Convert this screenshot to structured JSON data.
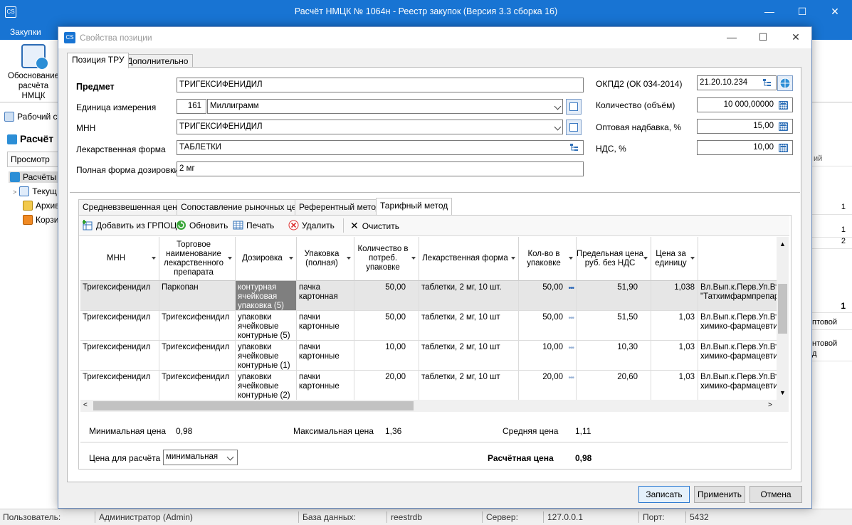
{
  "main_window": {
    "title": "Расчёт НМЦК № 1064н - Реестр закупок (Версия 3.3 сборка 16)",
    "app_icon_text": "CS",
    "ribbon_tab": "Закупки",
    "ribbon_button_line1": "Обоснование",
    "ribbon_button_line2": "расчёта НМЦК",
    "left_panel": {
      "workspace_tab": "Рабочий ст",
      "section_title": "Расчёт",
      "view_button": "Просмотр",
      "tree_root": "Расчёты",
      "tree_items": [
        "Текущ",
        "Архив",
        "Корзи"
      ]
    },
    "right_panel_values": [
      "ий",
      "1",
      "1",
      "2",
      "1",
      "птовой",
      "нтовой",
      "д"
    ],
    "statusbar": {
      "user_label": "Пользователь:",
      "user_value": "Администратор (Admin)",
      "db_label": "База данных:",
      "db_value": "reestrdb",
      "server_label": "Сервер:",
      "server_value": "127.0.0.1",
      "port_label": "Порт:",
      "port_value": "5432"
    }
  },
  "dialog": {
    "title": "Свойства позиции",
    "tabs": [
      "Позиция ТРУ",
      "Дополнительно"
    ],
    "fields": {
      "subject_label": "Предмет",
      "subject_value": "ТРИГЕКСИФЕНИДИЛ",
      "unit_label": "Единица измерения",
      "unit_code": "161",
      "unit_value": "Миллиграмм",
      "mnn_label": "МНН",
      "mnn_value": "ТРИГЕКСИФЕНИДИЛ",
      "form_label": "Лекарственная форма",
      "form_value": "ТАБЛЕТКИ",
      "dosage_label": "Полная форма дозировки",
      "dosage_value": "2 мг",
      "okpd_label": "ОКПД2 (ОК 034-2014)",
      "okpd_value": "21.20.10.234",
      "qty_label": "Количество (объём)",
      "qty_value": "10 000,00000",
      "markup_label": "Оптовая надбавка, %",
      "markup_value": "15,00",
      "vat_label": "НДС, %",
      "vat_value": "10,00"
    },
    "method_tabs": [
      "Средневзвешенная цена",
      "Сопоставление рыночных цен",
      "Референтный метод",
      "Тарифный метод"
    ],
    "toolbar": {
      "add": "Добавить из ГРПОЦ",
      "refresh": "Обновить",
      "print": "Печать",
      "delete": "Удалить",
      "clear": "Очистить"
    },
    "grid": {
      "columns": [
        "МНН",
        "Торговое наименование лекарственного препарата",
        "Дозировка",
        "Упаковка (полная)",
        "Количество в потреб. упаковке",
        "Лекарственная форма",
        "Кол-во в упаковке",
        "Предельная цена руб. без НДС",
        "Цена за единицу",
        ""
      ],
      "rows": [
        [
          "Тригексифенидил",
          "Паркопан",
          "контурная ячейковая упаковка (5)",
          "пачка картонная",
          "50,00",
          "таблетки, 2 мг, 10 шт.",
          "50,00",
          "51,90",
          "1,038",
          "Вл.Вып.к.Перв.Уп.Вто \"Татхимфармпрепарат"
        ],
        [
          "Тригексифенидил",
          "Тригексифенидил",
          "упаковки ячейковые контурные (5)",
          "пачки картонные",
          "50,00",
          "таблетки, 2 мг, 10 шт",
          "50,00",
          "51,50",
          "1,03",
          "Вл.Вып.к.Перв.Уп.Вто химико-фармацевтиче"
        ],
        [
          "Тригексифенидил",
          "Тригексифенидил",
          "упаковки ячейковые контурные (1)",
          "пачки картонные",
          "10,00",
          "таблетки, 2 мг, 10 шт",
          "10,00",
          "10,30",
          "1,03",
          "Вл.Вып.к.Перв.Уп.Вто химико-фармацевтиче"
        ],
        [
          "Тригексифенидил",
          "Тригексифенидил",
          "упаковки ячейковые контурные (2)",
          "пачки картонные",
          "20,00",
          "таблетки, 2 мг, 10 шт",
          "20,00",
          "20,60",
          "1,03",
          "Вл.Вып.к.Перв.Уп.Вто химико-фармацевтиче"
        ]
      ]
    },
    "summary": {
      "min_label": "Минимальная цена",
      "min_value": "0,98",
      "max_label": "Максимальная цена",
      "max_value": "1,36",
      "avg_label": "Средняя цена",
      "avg_value": "1,11",
      "calc_price_for_label": "Цена для расчёта",
      "calc_price_for_value": "минимальная",
      "calc_price_label": "Расчётная цена",
      "calc_price_value": "0,98"
    },
    "buttons": {
      "save": "Записать",
      "apply": "Применить",
      "cancel": "Отмена"
    }
  }
}
